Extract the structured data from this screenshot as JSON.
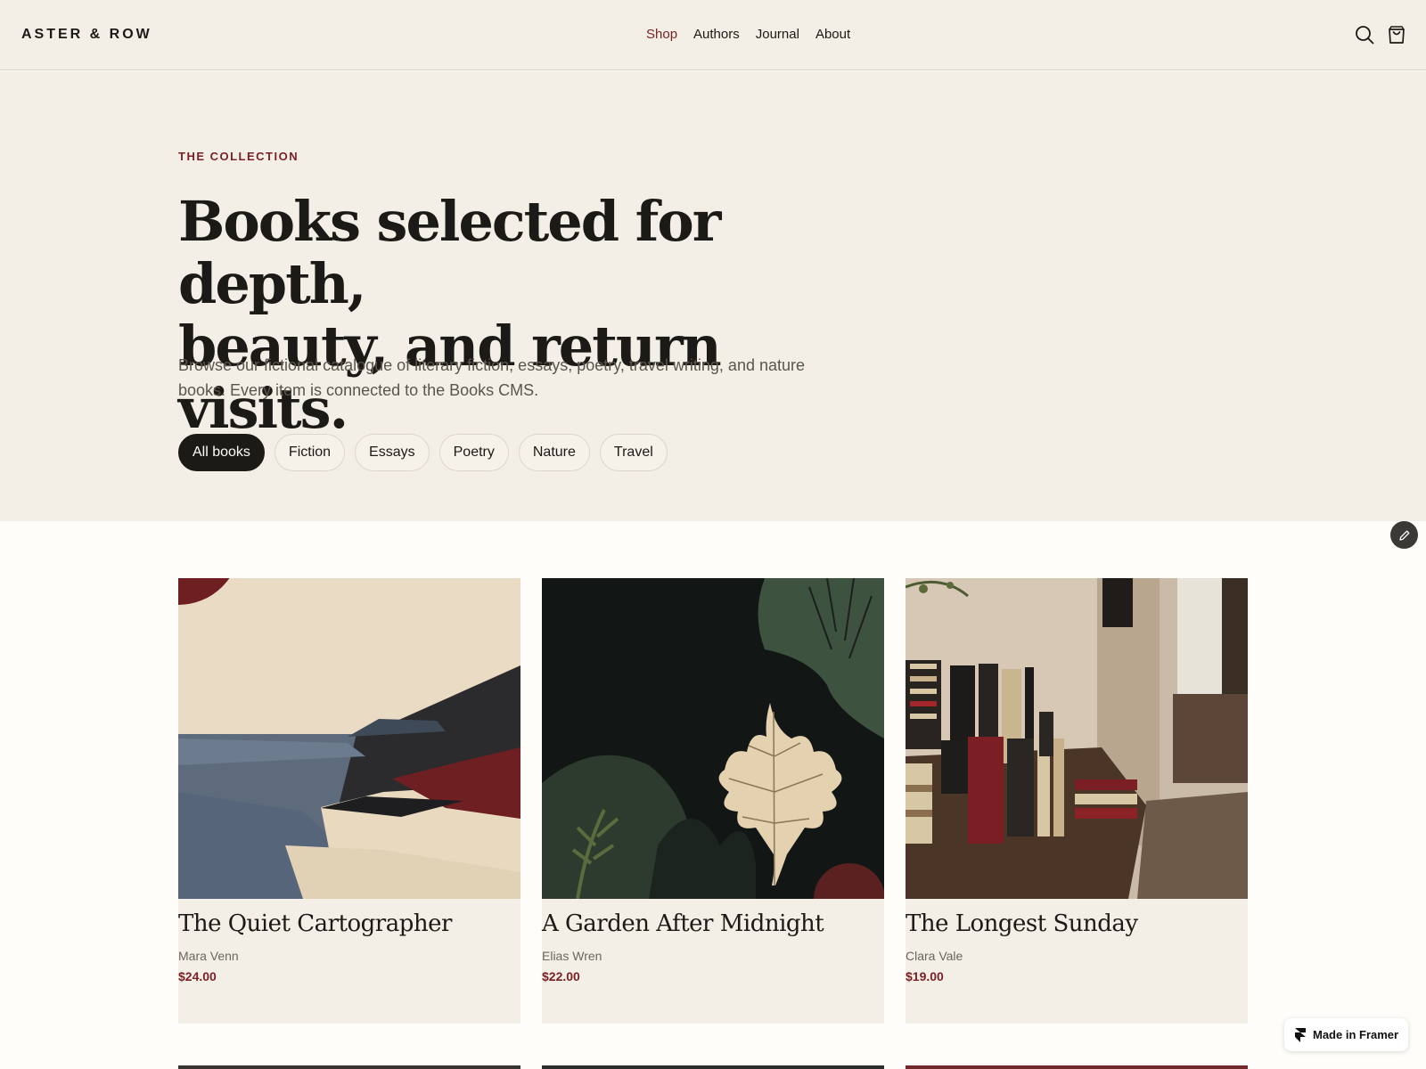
{
  "header": {
    "logo": "ASTER & ROW",
    "nav": [
      "Shop",
      "Authors",
      "Journal",
      "About"
    ],
    "active_nav": "Shop",
    "icons": [
      "search-icon",
      "cart-icon"
    ]
  },
  "hero": {
    "eyebrow": "THE COLLECTION",
    "title_line1": "Books selected for depth,",
    "title_line2": "beauty, and return visits.",
    "description": "Browse our fictional catalogue of literary fiction, essays, poetry, travel writing, and nature books. Every item is connected to the Books CMS.",
    "filters": [
      "All books",
      "Fiction",
      "Essays",
      "Poetry",
      "Nature",
      "Travel"
    ],
    "active_filter": "All books"
  },
  "books": [
    {
      "title": "The Quiet Cartographer",
      "author": "Mara Venn",
      "price": "$24.00",
      "cover": "coastal-landscape"
    },
    {
      "title": "A Garden After Midnight",
      "author": "Elias Wren",
      "price": "$22.00",
      "cover": "leaf-night"
    },
    {
      "title": "The Longest Sunday",
      "author": "Clara Vale",
      "price": "$19.00",
      "cover": "bookshop-interior"
    }
  ],
  "badge": {
    "label": "Made in Framer"
  },
  "colors": {
    "accent": "#7a1f24",
    "hero_bg": "#f3efe7",
    "page_bg": "#fefdf9",
    "ink": "#1c1a16"
  }
}
